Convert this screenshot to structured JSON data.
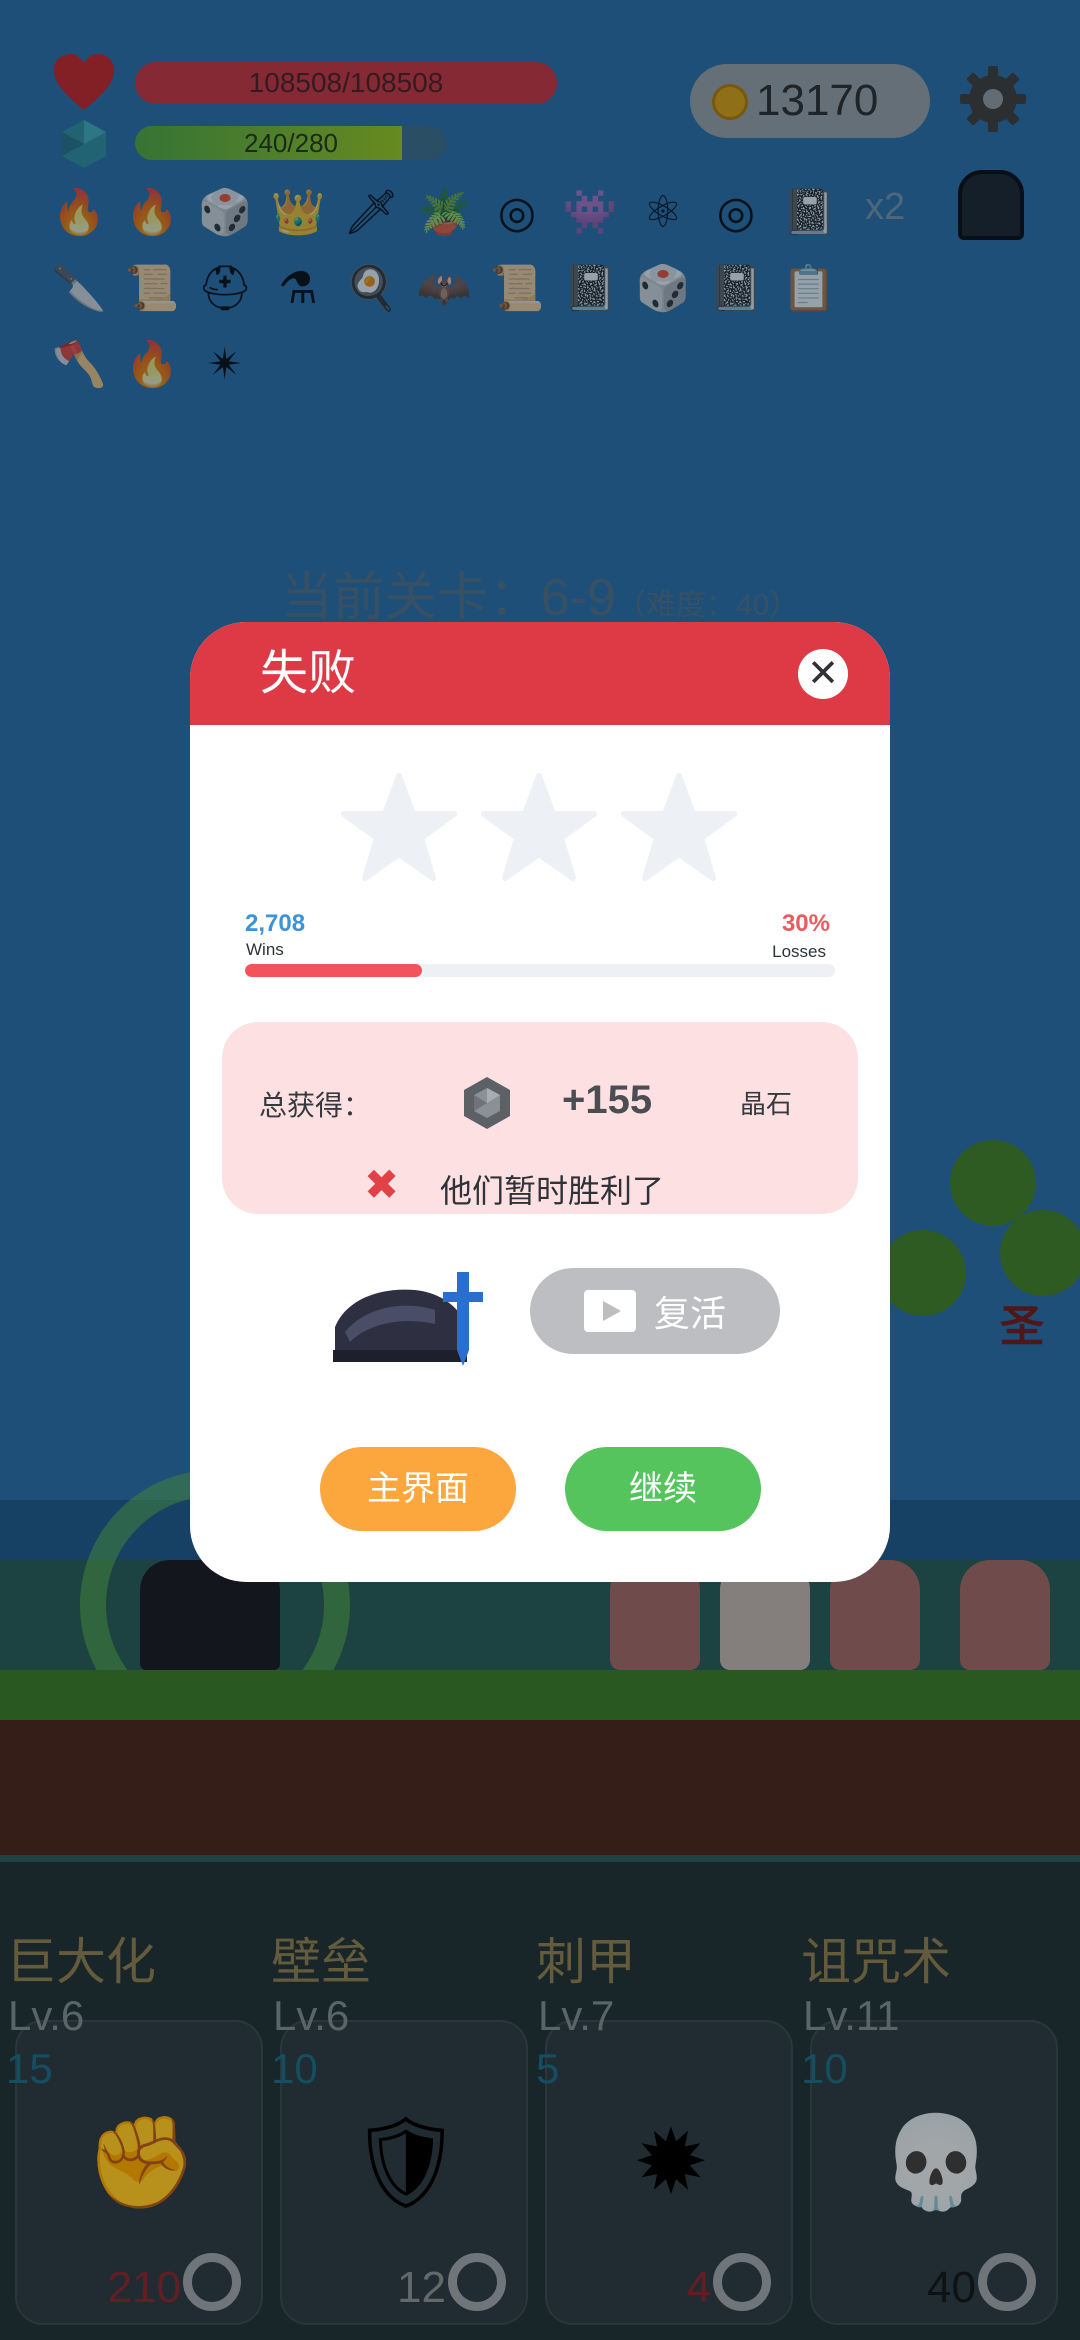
{
  "hud": {
    "hp_text": "108508/108508",
    "mp_text": "240/280",
    "mp_fraction": 0.857,
    "coins": "13170",
    "speed_multiplier": "x2"
  },
  "inventory_icons": [
    "torch-icon",
    "torch-icon",
    "dice-icon",
    "crown-icon",
    "sword-icon",
    "potted-plant-icon",
    "target-ring-icon",
    "green-monster-icon",
    "molecule-icon",
    "target-ring-icon",
    "skull-book-icon",
    "dagger-icon",
    "scroll-icon",
    "knight-helmet-icon",
    "mortar-pestle-icon",
    "fried-egg-icon",
    "bat-icon",
    "scroll-icon",
    "skull-book-icon",
    "dice-icon",
    "skull-book-icon",
    "checklist-icon",
    "axe-icon",
    "torch-icon",
    "spiked-mace-icon"
  ],
  "level": {
    "label": "当前关卡：6-9",
    "difficulty": "（难度：40）"
  },
  "dialog": {
    "title": "失败",
    "close_icon": "close-icon",
    "stars_earned": 0,
    "stars_total": 3,
    "wins_value": "2,708",
    "wins_label": "Wins",
    "losses_value": "30%",
    "losses_label": "Losses",
    "loss_fraction": 0.3,
    "reward_label": "总获得：",
    "reward_amount": "+155",
    "reward_unit": "晶石",
    "fail_message": "他们暂时胜利了",
    "revive_label": "复活",
    "home_label": "主界面",
    "continue_label": "继续"
  },
  "skills": [
    {
      "name": "巨大化",
      "level": "Lv.6",
      "cost": "15",
      "count": "210",
      "icon": "raised-fist-icon",
      "count_color": "#8a2a32"
    },
    {
      "name": "壁垒",
      "level": "Lv.6",
      "cost": "10",
      "count": "12",
      "icon": "armor-icon",
      "count_color": "#8a9094"
    },
    {
      "name": "刺甲",
      "level": "Lv.7",
      "cost": "5",
      "count": "4",
      "icon": "spiked-ball-icon",
      "count_color": "#8a2a32"
    },
    {
      "name": "诅咒术",
      "level": "Lv.11",
      "cost": "10",
      "count": "40",
      "icon": "skull-icon",
      "count_color": "#151a1d"
    }
  ],
  "colors": {
    "header_red": "#dd3a46",
    "home_orange": "#fca73e",
    "continue_green": "#56c45c",
    "wins_blue": "#3b93d8",
    "loss_red": "#f2545b"
  }
}
